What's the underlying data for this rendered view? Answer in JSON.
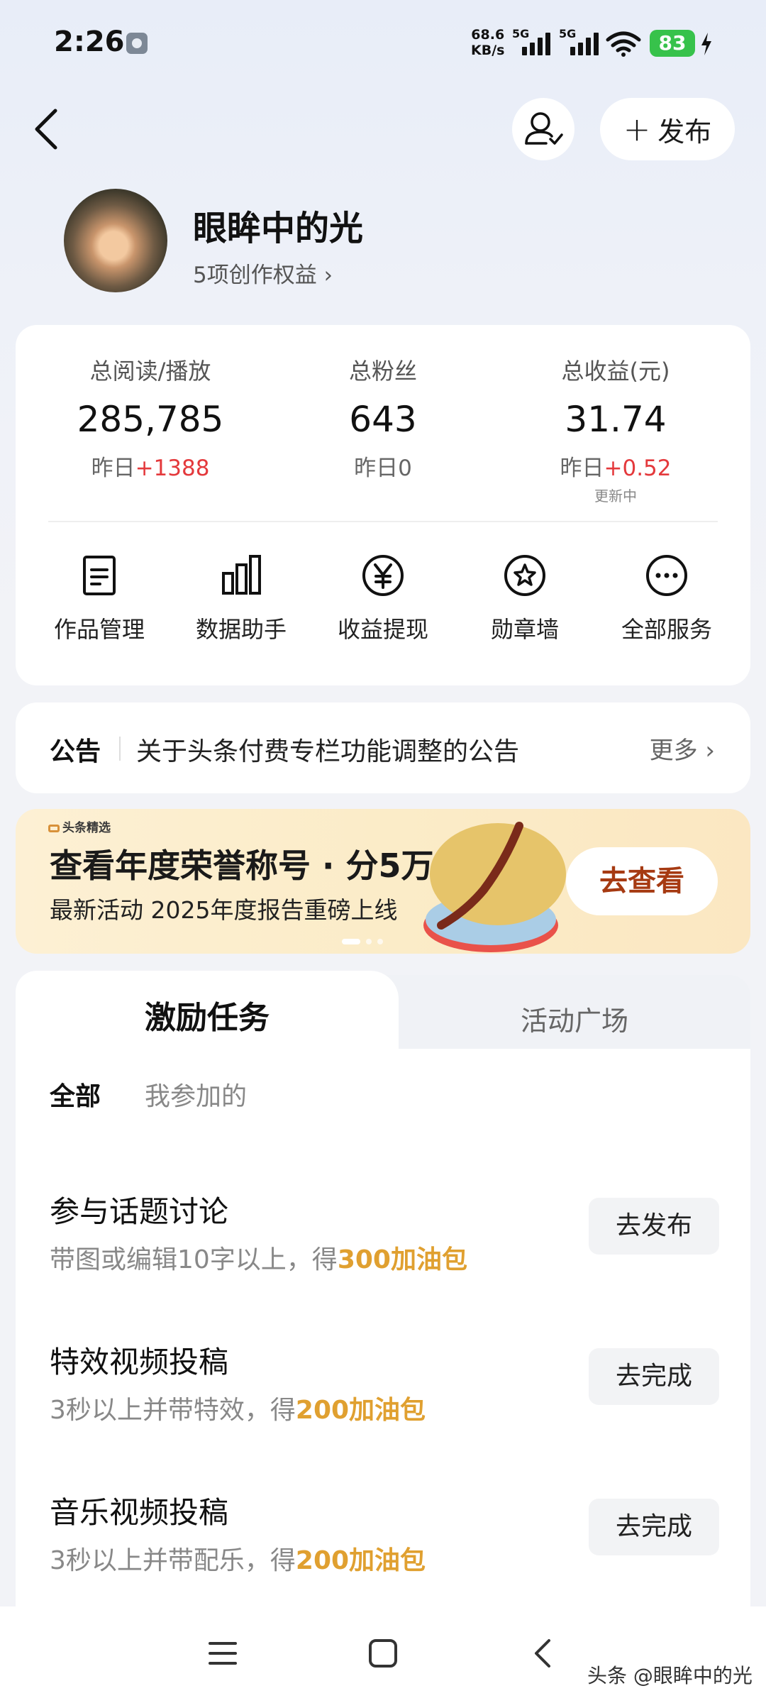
{
  "status_bar": {
    "time": "2:26",
    "speed_value": "68.6",
    "speed_unit": "KB/s",
    "net1": "5G",
    "net2": "5G",
    "battery": "83"
  },
  "header": {
    "publish_label": "发布"
  },
  "profile": {
    "username": "眼眸中的光",
    "rights_label": "5项创作权益 ›"
  },
  "stats": [
    {
      "label": "总阅读/播放",
      "value": "285,785",
      "delta_prefix": "昨日",
      "delta": "+1388"
    },
    {
      "label": "总粉丝",
      "value": "643",
      "delta_prefix": "昨日",
      "delta": "0"
    },
    {
      "label": "总收益(元)",
      "value": "31.74",
      "delta_prefix": "昨日",
      "delta": "+0.52",
      "note": "更新中"
    }
  ],
  "services": [
    {
      "label": "作品管理",
      "icon": "document-icon"
    },
    {
      "label": "数据助手",
      "icon": "bar-chart-icon"
    },
    {
      "label": "收益提现",
      "icon": "yen-icon"
    },
    {
      "label": "勋章墙",
      "icon": "medal-icon"
    },
    {
      "label": "全部服务",
      "icon": "more-icon"
    }
  ],
  "notice": {
    "tag": "公告",
    "text": "关于头条付费专栏功能调整的公告",
    "more": "更多 ›"
  },
  "banner": {
    "brand": "头条精选",
    "title": "查看年度荣誉称号 · 分5万",
    "subtitle": "最新活动 2025年度报告重磅上线",
    "button": "去查看"
  },
  "tabs": {
    "active": "激励任务",
    "inactive": "活动广场"
  },
  "filters": {
    "all": "全部",
    "mine": "我参加的"
  },
  "tasks": [
    {
      "title": "参与话题讨论",
      "desc": "带图或编辑10字以上，得",
      "reward": "300加油包",
      "button": "去发布"
    },
    {
      "title": "特效视频投稿",
      "desc": "3秒以上并带特效，得",
      "reward": "200加油包",
      "button": "去完成"
    },
    {
      "title": "音乐视频投稿",
      "desc": "3秒以上并带配乐，得",
      "reward": "200加油包",
      "button": "去完成"
    }
  ],
  "watermark": "头条 @眼眸中的光",
  "colors": {
    "accent_red": "#e4393c",
    "reward_gold": "#e0a030",
    "banner_button_text": "#a63a12",
    "battery_green": "#37c24b"
  }
}
